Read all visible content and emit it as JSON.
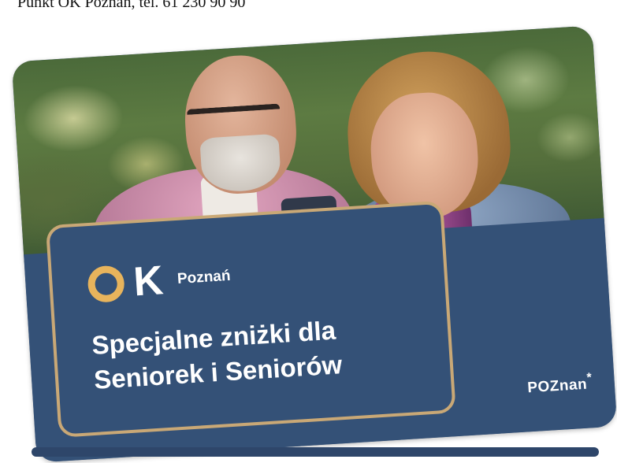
{
  "caption": {
    "text": "Punkt OK Poznań, tel. 61 230 90 90"
  },
  "card": {
    "colors": {
      "panel": "#345177",
      "gold_frame": "#c9a876",
      "ok_o": "#e8b45c"
    },
    "brand": {
      "logo_letter": "K",
      "city": "Poznań"
    },
    "headline": "Specjalne zniżki dla Seniorek i Seniorów",
    "city_logo": {
      "text": "POZnan",
      "mark": "*"
    }
  }
}
